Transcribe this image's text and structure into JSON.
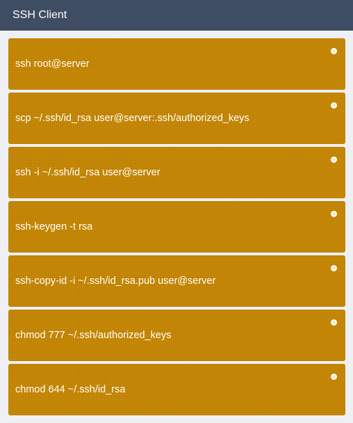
{
  "window": {
    "title": "SSH Client"
  },
  "items": [
    {
      "label": "ssh root@server"
    },
    {
      "label": "scp ~/.ssh/id_rsa user@server:.ssh/authorized_keys"
    },
    {
      "label": "ssh -i ~/.ssh/id_rsa user@server"
    },
    {
      "label": "ssh-keygen -t rsa"
    },
    {
      "label": "ssh-copy-id -i ~/.ssh/id_rsa.pub user@server"
    },
    {
      "label": "chmod 777 ~/.ssh/authorized_keys"
    },
    {
      "label": "chmod 644 ~/.ssh/id_rsa"
    }
  ],
  "colors": {
    "titlebar": "#3e4d63",
    "item_background": "#c98a06",
    "text": "#ffffff"
  },
  "icons": {
    "item_handle": "drag-handle-icon"
  }
}
